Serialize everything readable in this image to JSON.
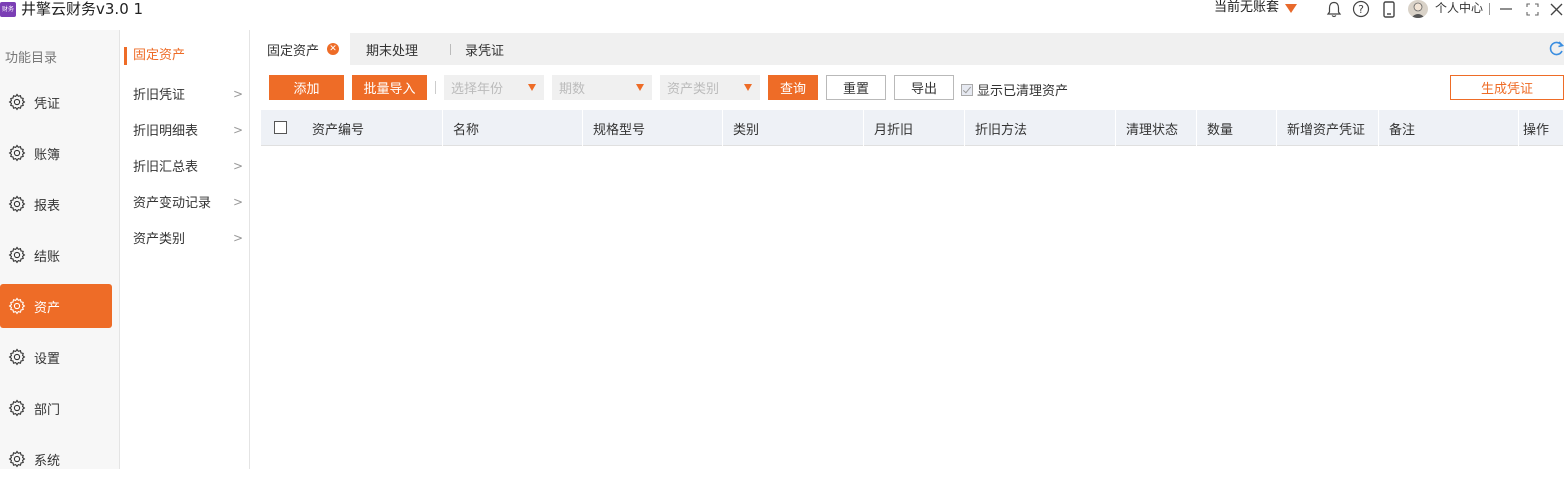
{
  "app": {
    "logo_text": "财务",
    "title": "井擎云财务v3.0 1"
  },
  "titlebar": {
    "account_label": "当前无账套",
    "user_label": "个人中心",
    "icons": [
      "bell-icon",
      "help-icon",
      "phone-icon",
      "avatar",
      "minimize-icon",
      "maximize-icon",
      "close-icon"
    ],
    "accent": "#ee6c27"
  },
  "sidebar": {
    "header": "功能目录",
    "items": [
      {
        "label": "凭证",
        "icon": "gear-icon"
      },
      {
        "label": "账簿",
        "icon": "gear-icon"
      },
      {
        "label": "报表",
        "icon": "gear-icon"
      },
      {
        "label": "结账",
        "icon": "gear-icon"
      },
      {
        "label": "资产",
        "icon": "gear-icon",
        "active": true
      },
      {
        "label": "设置",
        "icon": "gear-icon"
      },
      {
        "label": "部门",
        "icon": "gear-icon"
      },
      {
        "label": "系统",
        "icon": "gear-icon"
      }
    ]
  },
  "submenu": {
    "title": "固定资产",
    "items": [
      {
        "label": "折旧凭证"
      },
      {
        "label": "折旧明细表"
      },
      {
        "label": "折旧汇总表"
      },
      {
        "label": "资产变动记录"
      },
      {
        "label": "资产类别"
      }
    ]
  },
  "tabs": [
    {
      "label": "固定资产",
      "active": true
    },
    {
      "label": "期末处理"
    },
    {
      "label": "录凭证"
    }
  ],
  "toolbar": {
    "add": "添加",
    "batch_import": "批量导入",
    "year_placeholder": "选择年份",
    "period_placeholder": "期数",
    "category_placeholder": "资产类别",
    "query": "查询",
    "reset": "重置",
    "export": "导出",
    "show_cleared": "显示已清理资产",
    "generate_voucher": "生成凭证"
  },
  "table": {
    "columns": [
      "资产编号",
      "名称",
      "规格型号",
      "类别",
      "月折旧",
      "折旧方法",
      "清理状态",
      "数量",
      "新增资产凭证",
      "备注",
      "操作"
    ],
    "rows": []
  }
}
